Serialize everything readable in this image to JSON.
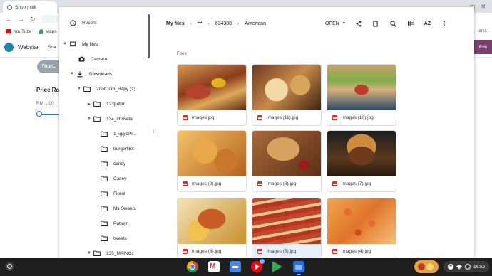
{
  "browser": {
    "tab_title": "Shop | xllll",
    "bookmarks": [
      "YouTube",
      "Maps"
    ],
    "site_name": "Website",
    "site_nav": "Sha",
    "logo_text": "YourL",
    "price_range_label": "Price Ra",
    "price_min": "RM 1.00",
    "right_fragment": "iarks",
    "edit_label": "Edit"
  },
  "files": {
    "nav": {
      "recent": "Recent",
      "my_files": "My files",
      "camera": "Camera",
      "downloads": "Downloads",
      "folders": [
        {
          "label": "2dotCom_Hapy (1)",
          "level": 1,
          "expand": "open"
        },
        {
          "label": "123puter",
          "level": 2,
          "expand": "closed"
        },
        {
          "label": "134_chrisela",
          "level": 2,
          "expand": "open"
        },
        {
          "label": "1_igglePl...",
          "level": 3,
          "expand": "none"
        },
        {
          "label": "burgerNet",
          "level": 3,
          "expand": "none"
        },
        {
          "label": "candy",
          "level": 3,
          "expand": "none"
        },
        {
          "label": "Casey",
          "level": 3,
          "expand": "none"
        },
        {
          "label": "Floral",
          "level": 3,
          "expand": "none"
        },
        {
          "label": "Ms Sweets",
          "level": 3,
          "expand": "none"
        },
        {
          "label": "Pattern",
          "level": 3,
          "expand": "none"
        },
        {
          "label": "tweets",
          "level": 3,
          "expand": "none"
        },
        {
          "label": "135_MAINCc",
          "level": 2,
          "expand": "open"
        }
      ]
    },
    "breadcrumb": {
      "root": "My files",
      "ellipsis": "•••",
      "middle": "634388",
      "current": "American"
    },
    "toolbar": {
      "open_label": "OPEN",
      "sort_label": "AZ"
    },
    "section_label": "Files",
    "items": [
      {
        "name": "images.jpg"
      },
      {
        "name": "images (11).jpg"
      },
      {
        "name": "images (10).jpg"
      },
      {
        "name": "images (9).jpg"
      },
      {
        "name": "images (8).jpg"
      },
      {
        "name": "images (7).jpg"
      },
      {
        "name": "images (6).jpg"
      },
      {
        "name": "images (5).jpg"
      },
      {
        "name": "images (4).jpg"
      }
    ]
  },
  "shelf": {
    "apps": [
      "chrome-icon",
      "gmail-icon",
      "docs-icon",
      "youtube-icon",
      "play-store-icon",
      "files-icon"
    ],
    "time": "16:52",
    "notification_count": "1"
  },
  "colors": {
    "accent": "#1a73e8",
    "shelf": "#1f1f1f",
    "edit_button": "#7b3f6e"
  }
}
